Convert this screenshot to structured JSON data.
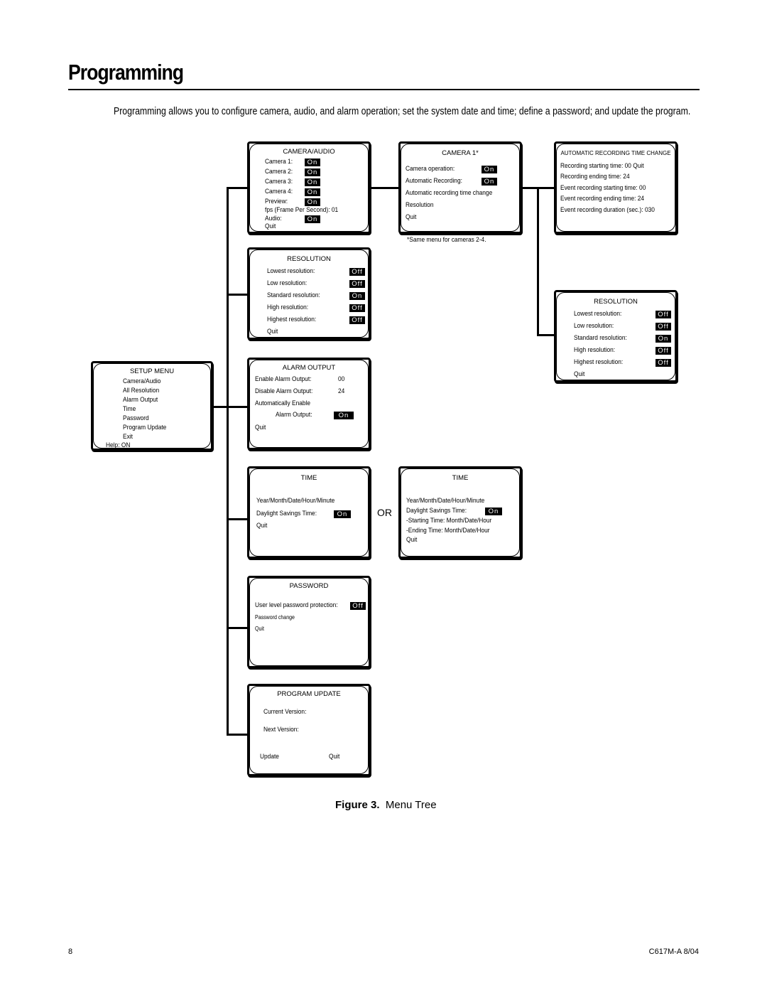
{
  "page": {
    "title": "Programming",
    "intro": "Programming allows you to configure camera, audio, and alarm operation; set the system date and time; define a password; and update the program.",
    "figure_label": "Figure 3.",
    "figure_caption": "Menu Tree",
    "or_label": "OR",
    "footnote": "*Same menu for cameras 2-4.",
    "page_number": "8",
    "doc_code": "C617M-A 8/04"
  },
  "setup_menu": {
    "title": "SETUP MENU",
    "items": [
      "Camera/Audio",
      "All Resolution",
      "Alarm Output",
      "Time",
      "Password",
      "Program Update",
      "Exit"
    ],
    "help": "Help: ON"
  },
  "camera_audio": {
    "title": "CAMERA/AUDIO",
    "rows": [
      {
        "label": "Camera 1:",
        "value": "On"
      },
      {
        "label": "Camera 2:",
        "value": "On"
      },
      {
        "label": "Camera 3:",
        "value": "On"
      },
      {
        "label": "Camera 4:",
        "value": "On"
      },
      {
        "label": "Preview:",
        "value": "On"
      }
    ],
    "fps": "fps (Frame Per Second): 01",
    "audio_label": "Audio:",
    "audio_value": "On",
    "quit": "Quit"
  },
  "camera1": {
    "title": "CAMERA 1*",
    "rows": [
      {
        "label": "Camera operation:",
        "value": "On"
      },
      {
        "label": "Automatic Recording:",
        "value": "On"
      }
    ],
    "items": [
      "Automatic recording time change",
      "Resolution",
      "Quit"
    ]
  },
  "auto_rec": {
    "title": "AUTOMATIC RECORDING TIME CHANGE",
    "lines": [
      "Recording starting time: 00   Quit",
      "Recording ending time: 24",
      "Event recording starting time: 00",
      "Event recording ending time: 24",
      "Event recording duration (sec.): 030"
    ]
  },
  "resolution": {
    "title": "RESOLUTION",
    "rows": [
      {
        "label": "Lowest resolution:",
        "value": "Off"
      },
      {
        "label": "Low resolution:",
        "value": "Off"
      },
      {
        "label": "Standard resolution:",
        "value": "On"
      },
      {
        "label": "High resolution:",
        "value": "Off"
      },
      {
        "label": "Highest resolution:",
        "value": "Off"
      }
    ],
    "quit": "Quit"
  },
  "resolution_cam": {
    "title": "RESOLUTION",
    "rows": [
      {
        "label": "Lowest resolution:",
        "value": "Off"
      },
      {
        "label": "Low resolution:",
        "value": "Off"
      },
      {
        "label": "Standard resolution:",
        "value": "On"
      },
      {
        "label": "High resolution:",
        "value": "Off"
      },
      {
        "label": "Highest resolution:",
        "value": "Off"
      }
    ],
    "quit": "Quit"
  },
  "alarm_output": {
    "title": "ALARM OUTPUT",
    "enable_label": "Enable Alarm Output:",
    "enable_value": "00",
    "disable_label": "Disable Alarm Output:",
    "disable_value": "24",
    "auto_label": "Automatically Enable",
    "auto_sub_label": "Alarm Output:",
    "auto_value": "On",
    "quit": "Quit"
  },
  "time_a": {
    "title": "TIME",
    "datetime": "Year/Month/Date/Hour/Minute",
    "dst_label": "Daylight Savings  Time:",
    "dst_value": "On",
    "quit": "Quit"
  },
  "time_b": {
    "title": "TIME",
    "datetime": "Year/Month/Date/Hour/Minute",
    "dst_label": "Daylight Savings  Time:",
    "dst_value": "On",
    "start": "-Starting Time:  Month/Date/Hour",
    "end": "-Ending Time:  Month/Date/Hour",
    "quit": "Quit"
  },
  "password": {
    "title": "PASSWORD",
    "protect_label": "User level password protection:",
    "protect_value": "Off",
    "change": "Password change",
    "quit": "Quit"
  },
  "program_update": {
    "title": "PROGRAM UPDATE",
    "current": "Current Version:",
    "next": "Next Version:",
    "update": "Update",
    "quit": "Quit"
  }
}
